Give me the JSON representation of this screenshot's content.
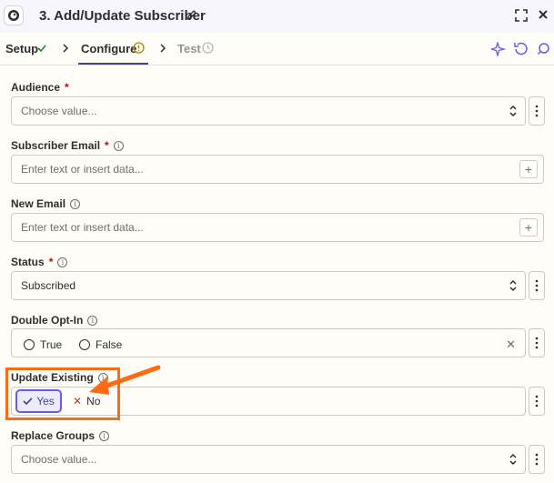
{
  "header": {
    "title": "3. Add/Update Subscriber",
    "app_icon": "mailchimp-icon"
  },
  "tabs": {
    "setup": "Setup",
    "configure": "Configure",
    "test": "Test"
  },
  "fields": {
    "audience": {
      "label": "Audience",
      "required": "*",
      "placeholder": "Choose value..."
    },
    "subscriber_email": {
      "label": "Subscriber Email",
      "required": "*",
      "placeholder": "Enter text or insert data..."
    },
    "new_email": {
      "label": "New Email",
      "placeholder": "Enter text or insert data..."
    },
    "status": {
      "label": "Status",
      "required": "*",
      "value": "Subscribed"
    },
    "double_opt_in": {
      "label": "Double Opt-In",
      "option_true": "True",
      "option_false": "False"
    },
    "update_existing": {
      "label": "Update Existing",
      "yes": "Yes",
      "no": "No"
    },
    "replace_groups": {
      "label": "Replace Groups",
      "placeholder": "Choose value..."
    }
  },
  "colors": {
    "accent": "#695be8",
    "highlight": "#ff6a13",
    "required": "#d40000"
  }
}
